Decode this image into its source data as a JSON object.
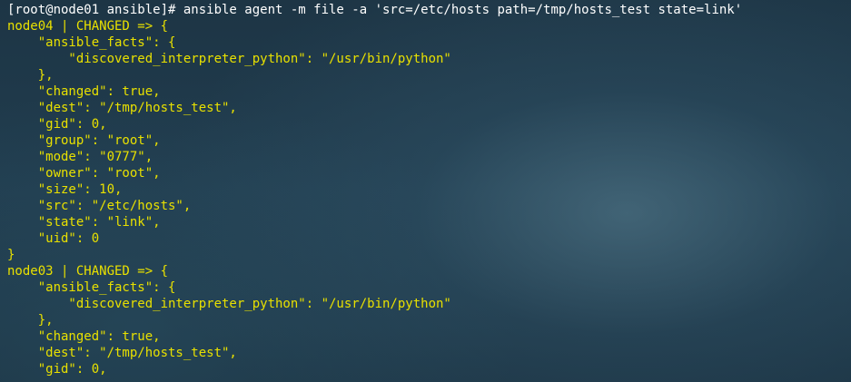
{
  "terminal": {
    "colors": {
      "prompt": "#ffffff",
      "changed_output": "#e8e000",
      "background": "#1f3a4b"
    },
    "lines": [
      "[root@node01 ansible]# ansible agent -m file -a 'src=/etc/hosts path=/tmp/hosts_test state=link'",
      "node04 | CHANGED => {",
      "    \"ansible_facts\": {",
      "        \"discovered_interpreter_python\": \"/usr/bin/python\"",
      "    },",
      "    \"changed\": true,",
      "    \"dest\": \"/tmp/hosts_test\",",
      "    \"gid\": 0,",
      "    \"group\": \"root\",",
      "    \"mode\": \"0777\",",
      "    \"owner\": \"root\",",
      "    \"size\": 10,",
      "    \"src\": \"/etc/hosts\",",
      "    \"state\": \"link\",",
      "    \"uid\": 0",
      "}",
      "node03 | CHANGED => {",
      "    \"ansible_facts\": {",
      "        \"discovered_interpreter_python\": \"/usr/bin/python\"",
      "    },",
      "    \"changed\": true,",
      "    \"dest\": \"/tmp/hosts_test\",",
      "    \"gid\": 0,"
    ]
  }
}
